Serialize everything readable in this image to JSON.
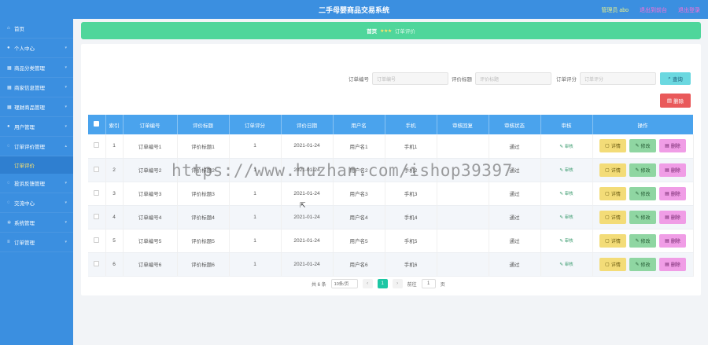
{
  "header": {
    "title": "二手母婴商品交易系统",
    "admin_label": "管理员 abo",
    "exit_front": "退出到前台",
    "logout": "退出登录"
  },
  "sidebar": {
    "items": [
      {
        "label": "首页",
        "icon": "home-icon"
      },
      {
        "label": "个人中心",
        "icon": "user-icon"
      },
      {
        "label": "商品分类管理",
        "icon": "grid-icon"
      },
      {
        "label": "商家信息管理",
        "icon": "grid-icon"
      },
      {
        "label": "理财商品管理",
        "icon": "grid-icon"
      },
      {
        "label": "用户管理",
        "icon": "users-icon"
      },
      {
        "label": "订单评价管理",
        "icon": "chat-icon"
      },
      {
        "label": "投诉反馈管理",
        "icon": "chat-icon"
      },
      {
        "label": "交流中心",
        "icon": "chat-icon"
      },
      {
        "label": "系统管理",
        "icon": "gear-icon"
      },
      {
        "label": "订单管理",
        "icon": "list-icon"
      }
    ],
    "sub_item": "订单评价"
  },
  "breadcrumb": {
    "home": "首页",
    "current": "订单评价"
  },
  "search": {
    "order_no_label": "订单编号",
    "order_no_placeholder": "订单编号",
    "title_label": "评价标题",
    "title_placeholder": "评价标题",
    "score_label": "订单评分",
    "score_placeholder": "订单评分",
    "search_btn": "查询",
    "delete_btn": "删除"
  },
  "table": {
    "headers": [
      "索引",
      "订单编号",
      "评价标题",
      "订单评分",
      "评价日期",
      "用户名",
      "手机",
      "审核回复",
      "审核状态",
      "审核",
      "操作"
    ],
    "audit_label": "审核",
    "ops": {
      "detail": "详情",
      "edit": "修改",
      "delete": "删除"
    },
    "rows": [
      {
        "index": "1",
        "order_no": "订单编号1",
        "title": "评价标题1",
        "score": "1",
        "date": "2021-01-24",
        "username": "用户名1",
        "phone": "手机1",
        "reply": "",
        "status": "通过"
      },
      {
        "index": "2",
        "order_no": "订单编号2",
        "title": "评价标题2",
        "score": "1",
        "date": "2021-01-24",
        "username": "用户名2",
        "phone": "手机2",
        "reply": "",
        "status": "通过"
      },
      {
        "index": "3",
        "order_no": "订单编号3",
        "title": "评价标题3",
        "score": "1",
        "date": "2021-01-24",
        "username": "用户名3",
        "phone": "手机3",
        "reply": "",
        "status": "通过"
      },
      {
        "index": "4",
        "order_no": "订单编号4",
        "title": "评价标题4",
        "score": "1",
        "date": "2021-01-24",
        "username": "用户名4",
        "phone": "手机4",
        "reply": "",
        "status": "通过"
      },
      {
        "index": "5",
        "order_no": "订单编号5",
        "title": "评价标题5",
        "score": "1",
        "date": "2021-01-24",
        "username": "用户名5",
        "phone": "手机5",
        "reply": "",
        "status": "通过"
      },
      {
        "index": "6",
        "order_no": "订单编号6",
        "title": "评价标题6",
        "score": "1",
        "date": "2021-01-24",
        "username": "用户名6",
        "phone": "手机6",
        "reply": "",
        "status": "通过"
      }
    ]
  },
  "pagination": {
    "total": "共 6 条",
    "page_size": "10条/页",
    "prev": "‹",
    "current": "1",
    "next": "›",
    "goto_label": "前往",
    "goto_value": "1",
    "page_suffix": "页"
  },
  "watermark": "https://www.huzhan.com/ishop39397",
  "colors": {
    "topbar": "#3b8fe0",
    "breadcrumb": "#4fd69b",
    "table_header": "#4aa3ed",
    "pager_active": "#1cc7a4"
  }
}
